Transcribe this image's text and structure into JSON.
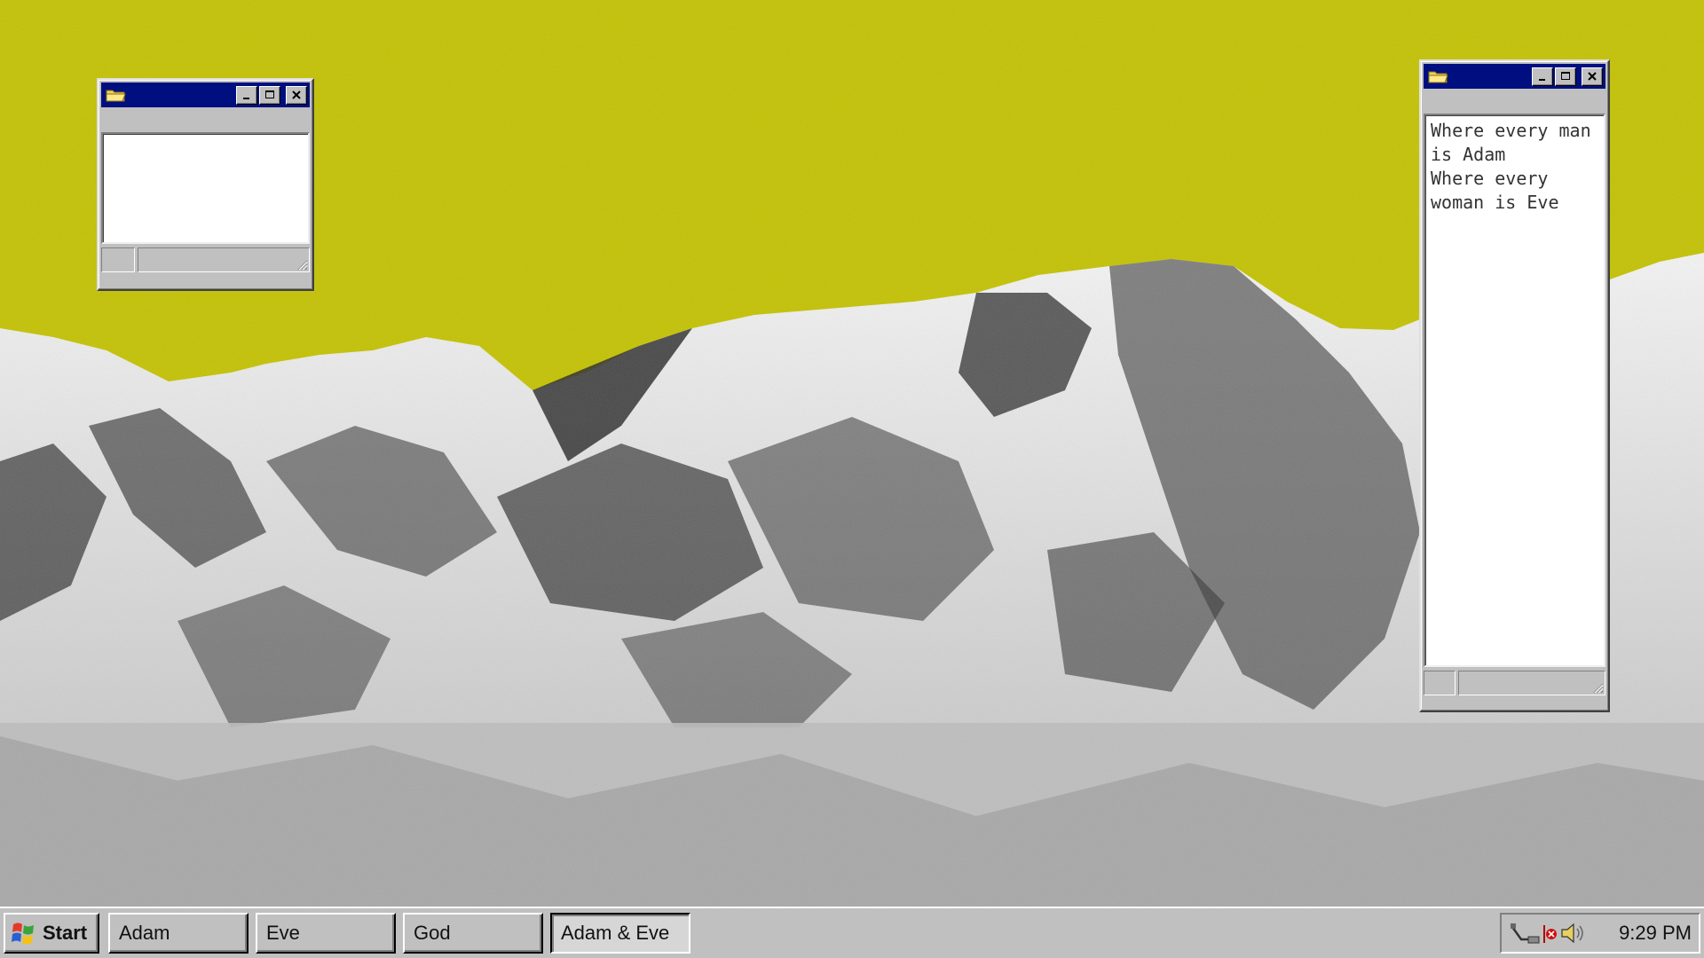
{
  "desktop": {
    "sky_color": "#c4c200",
    "wallpaper": "snowy-mountain-range-icon"
  },
  "windows": [
    {
      "id": "small-window",
      "title_icon": "folder-icon",
      "controls": [
        "minimize-icon",
        "maximize-icon",
        "close-icon"
      ],
      "text": ""
    },
    {
      "id": "text-window",
      "title_icon": "folder-icon",
      "controls": [
        "minimize-icon",
        "maximize-icon",
        "close-icon"
      ],
      "text": "Where every man\nis Adam\nWhere every\nwoman is Eve"
    }
  ],
  "taskbar": {
    "start_label": "Start",
    "tasks": [
      {
        "label": "Adam",
        "active": false
      },
      {
        "label": "Eve",
        "active": false
      },
      {
        "label": "God",
        "active": false
      },
      {
        "label": "Adam & Eve",
        "active": true
      }
    ],
    "tray_icons": [
      "network-icon",
      "error-icon",
      "volume-icon"
    ],
    "clock": "9:29 PM"
  }
}
